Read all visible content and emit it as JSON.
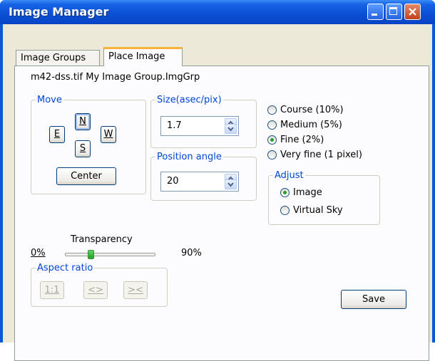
{
  "window": {
    "title": "Image Manager"
  },
  "tabs": [
    {
      "label": "Image Groups"
    },
    {
      "label": "Place Image"
    }
  ],
  "file_label": "m42-dss.tif My Image Group.ImgGrp",
  "move": {
    "legend": "Move",
    "north": "N",
    "east": "E",
    "west": "W",
    "south": "S",
    "center": "Center"
  },
  "size": {
    "legend": "Size(asec/pix)",
    "value": "1.7"
  },
  "position_angle": {
    "legend": "Position angle",
    "value": "20"
  },
  "precision": {
    "options": [
      {
        "label": "Course (10%)",
        "selected": false
      },
      {
        "label": "Medium (5%)",
        "selected": false
      },
      {
        "label": "Fine (2%)",
        "selected": true
      },
      {
        "label": "Very fine (1 pixel)",
        "selected": false
      }
    ]
  },
  "adjust": {
    "legend": "Adjust",
    "options": [
      {
        "label": "Image",
        "selected": true
      },
      {
        "label": "Virtual Sky",
        "selected": false
      }
    ]
  },
  "transparency": {
    "label": "Transparency",
    "min_label": "0%",
    "max_label": "90%",
    "value_fraction": 0.28
  },
  "aspect_ratio": {
    "legend": "Aspect ratio",
    "buttons": [
      "1:1",
      "<>",
      "><"
    ]
  },
  "save": "Save",
  "colors": {
    "title_bar": "#0a4fd3",
    "legend_text": "#0046d5",
    "selected_radio": "#21a121"
  }
}
